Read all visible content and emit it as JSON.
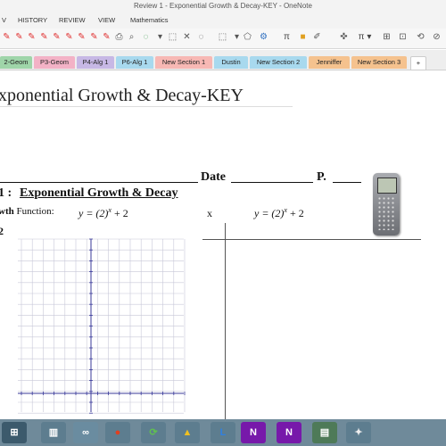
{
  "window": {
    "title": "Review 1 - Exponential Growth & Decay-KEY - OneNote"
  },
  "ribbon_tabs": [
    "V",
    "HISTORY",
    "REVIEW",
    "VIEW",
    "Mathematics"
  ],
  "toolbar": {
    "pi_symbol": "π",
    "pi_dropdown": "π ▾"
  },
  "sections": [
    {
      "label": "2-Geom",
      "color": "#9fd5a9"
    },
    {
      "label": "P3-Geom",
      "color": "#f3b2c6"
    },
    {
      "label": "P4-Alg 1",
      "color": "#c7b8e5"
    },
    {
      "label": "P6-Alg 1",
      "color": "#a8d9ee"
    },
    {
      "label": "New Section 1",
      "color": "#f7b8b4"
    },
    {
      "label": "Dustin",
      "color": "#a8d9ee"
    },
    {
      "label": "New Section 2",
      "color": "#a8d9ee"
    },
    {
      "label": "Jenniffer",
      "color": "#f5c28e"
    },
    {
      "label": "New Section 3",
      "color": "#f5c28e"
    },
    {
      "label": "+",
      "color": "#ffffff"
    }
  ],
  "page": {
    "title": "xponential Growth & Decay-KEY",
    "date_label": "Date",
    "period_label": "P.",
    "heading_number": "1 :",
    "heading": "Exponential Growth & Decay",
    "function_label": "wth Function:",
    "equation_left": "y = (2)",
    "exponent": "x",
    "equation_tail": "+ 2",
    "x_label": "x",
    "equation_right": "y = (2)",
    "side_mark": "2"
  },
  "colors": {
    "accent_purple": "#7719aa",
    "taskbar": "#6f8a9a"
  }
}
